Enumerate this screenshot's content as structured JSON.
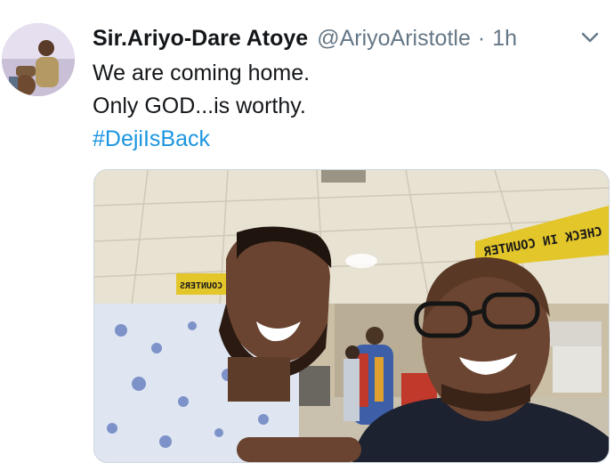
{
  "tweet": {
    "author_name": "Sir.Ariyo-Dare Atoye",
    "handle": "@AriyoAristotle",
    "separator": "·",
    "time": "1h",
    "lines": [
      "We are coming home.",
      "Only GOD...is worthy."
    ],
    "hashtag": "#DejiIsBack"
  },
  "media": {
    "sign_right": "CHECK IN COUNTER",
    "sign_left": "COUNTERS"
  },
  "colors": {
    "text": "#14171a",
    "secondary": "#657786",
    "link": "#1b95e0"
  },
  "icons": {
    "more": "chevron-down-icon"
  }
}
